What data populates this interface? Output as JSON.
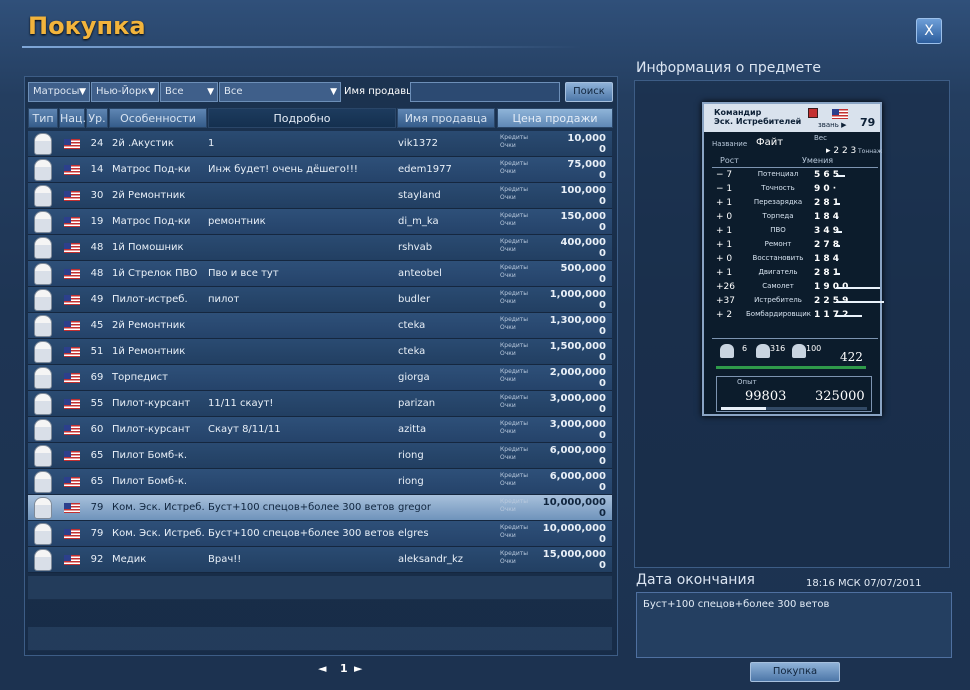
{
  "window": {
    "title": "Покупка",
    "close_label": "X"
  },
  "filters": {
    "type": "Матросы",
    "port": "Нью-Йорк",
    "rank": "Все",
    "level": "Все",
    "seller_label": "Имя продавца",
    "seller_value": "",
    "search_label": "Поиск"
  },
  "columns": {
    "type": "Тип",
    "nation": "Нац.",
    "level": "Ур.",
    "features": "Особенности",
    "details": "Подробно",
    "seller": "Имя продавца",
    "price": "Цена продажи"
  },
  "currency_labels": {
    "credits": "Кредиты",
    "points": "Очки"
  },
  "rows": [
    {
      "level": "24",
      "rank": "2й .Акустик",
      "desc": "1",
      "seller": "vik1372",
      "price": "10,000",
      "points": "0"
    },
    {
      "level": "14",
      "rank": "Матрос Под-ки",
      "desc": "Инж будет! очень дёшего!!!",
      "seller": "edem1977",
      "price": "75,000",
      "points": "0"
    },
    {
      "level": "30",
      "rank": "2й Ремонтник",
      "desc": "",
      "seller": "stayland",
      "price": "100,000",
      "points": "0"
    },
    {
      "level": "19",
      "rank": "Матрос Под-ки",
      "desc": "ремонтник",
      "seller": "di_m_ka",
      "price": "150,000",
      "points": "0"
    },
    {
      "level": "48",
      "rank": "1й Помошник",
      "desc": "",
      "seller": "rshvab",
      "price": "400,000",
      "points": "0"
    },
    {
      "level": "48",
      "rank": "1й Стрелок ПВО",
      "desc": "Пво и все тут",
      "seller": "anteobel",
      "price": "500,000",
      "points": "0"
    },
    {
      "level": "49",
      "rank": "Пилот-истреб.",
      "desc": "пилот",
      "seller": "budler",
      "price": "1,000,000",
      "points": "0"
    },
    {
      "level": "45",
      "rank": "2й Ремонтник",
      "desc": "",
      "seller": "cteka",
      "price": "1,300,000",
      "points": "0"
    },
    {
      "level": "51",
      "rank": "1й Ремонтник",
      "desc": "",
      "seller": "cteka",
      "price": "1,500,000",
      "points": "0"
    },
    {
      "level": "69",
      "rank": "Торпедист",
      "desc": "",
      "seller": "giorga",
      "price": "2,000,000",
      "points": "0"
    },
    {
      "level": "55",
      "rank": "Пилот-курсант",
      "desc": "11/11 скаут!",
      "seller": "parizan",
      "price": "3,000,000",
      "points": "0"
    },
    {
      "level": "60",
      "rank": "Пилот-курсант",
      "desc": "Скаут 8/11/11",
      "seller": "azitta",
      "price": "3,000,000",
      "points": "0"
    },
    {
      "level": "65",
      "rank": "Пилот Бомб-к.",
      "desc": "",
      "seller": "riong",
      "price": "6,000,000",
      "points": "0"
    },
    {
      "level": "65",
      "rank": "Пилот Бомб-к.",
      "desc": "",
      "seller": "riong",
      "price": "6,000,000",
      "points": "0"
    },
    {
      "level": "79",
      "rank": "Ком. Эск. Истреб.",
      "desc": "Буст+100 спецов+более 300 ветов",
      "seller": "gregor",
      "price": "10,000,000",
      "points": "0",
      "selected": true
    },
    {
      "level": "79",
      "rank": "Ком. Эск. Истреб.",
      "desc": "Буст+100 спецов+более 300 ветов",
      "seller": "elgres",
      "price": "10,000,000",
      "points": "0"
    },
    {
      "level": "92",
      "rank": "Медик",
      "desc": "Врач!!",
      "seller": "aleksandr_kz",
      "price": "15,000,000",
      "points": "0"
    }
  ],
  "pager": {
    "prev": "◄",
    "page": "1",
    "next": "►"
  },
  "info": {
    "title": "Информация о предмете",
    "card": {
      "rank_line1": "Командир",
      "rank_line2": "Эск. Истребителей",
      "rank_suffix": "звань ▶",
      "level": "79",
      "name_label": "Название",
      "name": "Файт",
      "weight_label": "Вес",
      "weight": "▸ 2 2 3",
      "tonnage_label": "Тоннаж",
      "growth_label": "Рост",
      "skills_label": "Умения",
      "stats": [
        {
          "growth": "− 7",
          "name": "Потенциал",
          "value": "5 6 5",
          "bar": 0.18
        },
        {
          "growth": "− 1",
          "name": "Точность",
          "value": "9 0 ·",
          "bar": 0.0
        },
        {
          "growth": "+ 1",
          "name": "Перезарядка",
          "value": "2 8 1",
          "bar": 0.08
        },
        {
          "growth": "+ 0",
          "name": "Торпеда",
          "value": "1 8 4",
          "bar": 0.05
        },
        {
          "growth": "+ 1",
          "name": "ПВО",
          "value": "3 4 9",
          "bar": 0.12
        },
        {
          "growth": "+ 1",
          "name": "Ремонт",
          "value": "2 7 8",
          "bar": 0.08
        },
        {
          "growth": "+ 0",
          "name": "Восстановить",
          "value": "1 8 4",
          "bar": 0.05
        },
        {
          "growth": "+ 1",
          "name": "Двигатель",
          "value": "2 8 1",
          "bar": 0.08
        },
        {
          "growth": "+26",
          "name": "Самолет",
          "value": "1 9 0 0",
          "bar": 0.92
        },
        {
          "growth": "+37",
          "name": "Истребитель",
          "value": "2 2 5 9",
          "bar": 1.0
        },
        {
          "growth": "+ 2",
          "name": "Бомбардировщик",
          "value": "1 1 7 2",
          "bar": 0.55
        }
      ],
      "crew_counts": [
        "6",
        "316",
        "100"
      ],
      "crew_total": "422",
      "exp_label": "Опыт",
      "exp_current": "99803",
      "exp_max": "325000",
      "exp_fraction": 0.307
    }
  },
  "end": {
    "title": "Дата окончания",
    "datetime": "18:16 МСК 07/07/2011",
    "description": "Буст+100 спецов+более 300 ветов"
  },
  "buy_button": "Покупка"
}
